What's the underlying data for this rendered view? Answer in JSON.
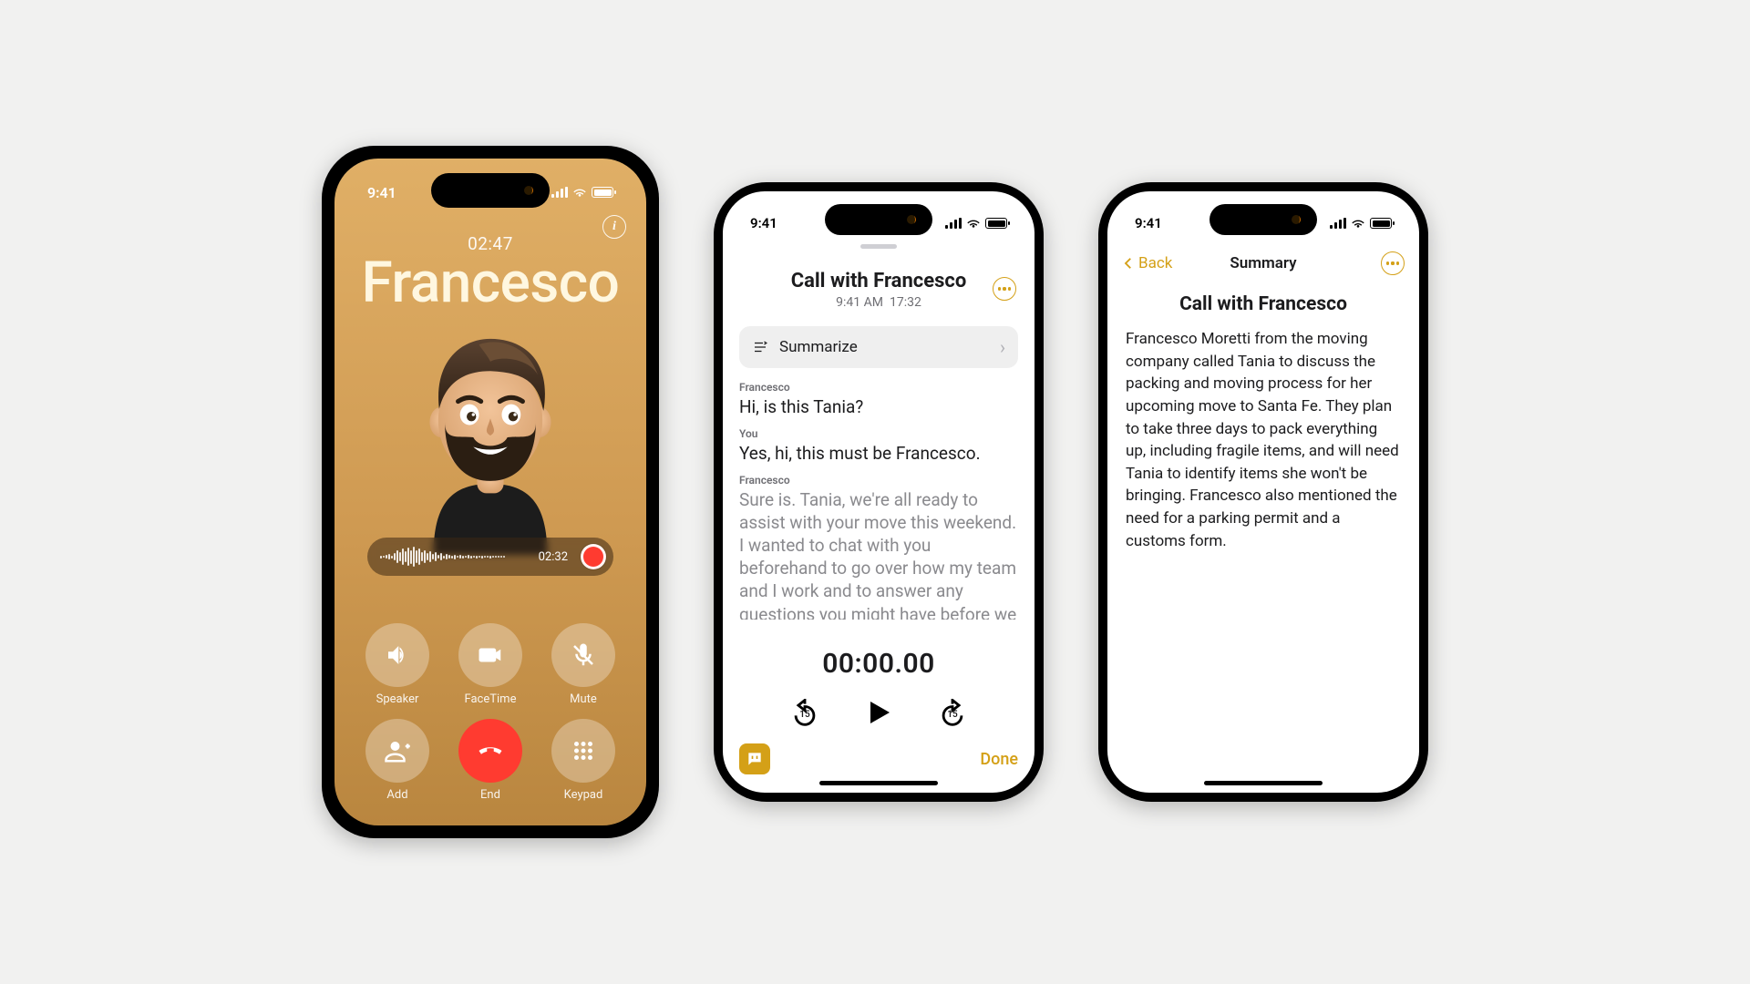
{
  "status": {
    "time": "9:41"
  },
  "call": {
    "duration": "02:47",
    "name": "Francesco",
    "recording_time": "02:32",
    "buttons": {
      "speaker": "Speaker",
      "facetime": "FaceTime",
      "mute": "Mute",
      "add": "Add",
      "end": "End",
      "keypad": "Keypad"
    }
  },
  "transcript": {
    "title": "Call with Francesco",
    "subtitle_time": "9:41 AM",
    "subtitle_dur": "17:32",
    "summarize_label": "Summarize",
    "messages": [
      {
        "speaker": "Francesco",
        "text": "Hi, is this Tania?"
      },
      {
        "speaker": "You",
        "text": "Yes, hi, this must be Francesco."
      },
      {
        "speaker": "Francesco",
        "text": "Sure is. Tania, we're all ready to assist with your move this weekend. I wanted to chat with you beforehand to go over how my team and I work and to answer any questions you might have before we arrive Saturday"
      }
    ],
    "playback_time": "00:00.00",
    "skip_seconds": "15",
    "done_label": "Done"
  },
  "summary": {
    "back_label": "Back",
    "nav_title": "Summary",
    "title": "Call with Francesco",
    "body": "Francesco Moretti from the moving company called Tania to discuss the packing and moving process for her upcoming move to Santa Fe. They plan to take three days to pack everything up, including fragile items, and will need Tania to identify items she won't be bringing. Francesco also mentioned the need for a parking permit and a customs form."
  }
}
